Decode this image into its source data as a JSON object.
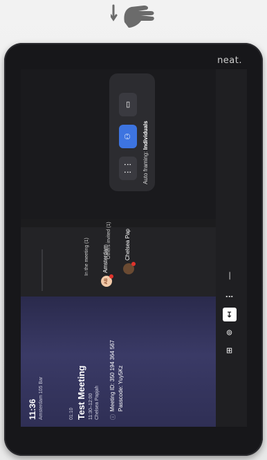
{
  "brand": "neat.",
  "meeting": {
    "clock": "11:36",
    "room": "Amsterdam 105 Bar",
    "index": "01:10",
    "title": "Test Meeting",
    "range": "11:30–12:00",
    "host": "Chelsea Papjah",
    "meeting_id": "Meeting ID: 350 194 364 567",
    "passcode": "Passcode: Yuy5Kz"
  },
  "participants": {
    "in_meeting_label": "In the meeting (1)",
    "others_label": "Others invited (1)",
    "items": [
      {
        "initials": "AB",
        "name": "Amsterdam"
      },
      {
        "initials": "",
        "name": "Chelsea Pap"
      }
    ]
  },
  "framing": {
    "caption_prefix": "Auto framing:",
    "caption_value": "Individuals"
  },
  "icons": {
    "gesture": "swipe-down-hand-icon",
    "framing_group": "group-framing-icon",
    "framing_individuals": "individuals-framing-icon",
    "framing_speaker": "speaker-framing-icon",
    "grid": "grid-icon",
    "share": "share-icon",
    "exit": "leave-icon",
    "more": "more-icon",
    "minus": "minus-icon"
  },
  "colors": {
    "accent": "#3d74e0",
    "alert": "#e0332c"
  }
}
